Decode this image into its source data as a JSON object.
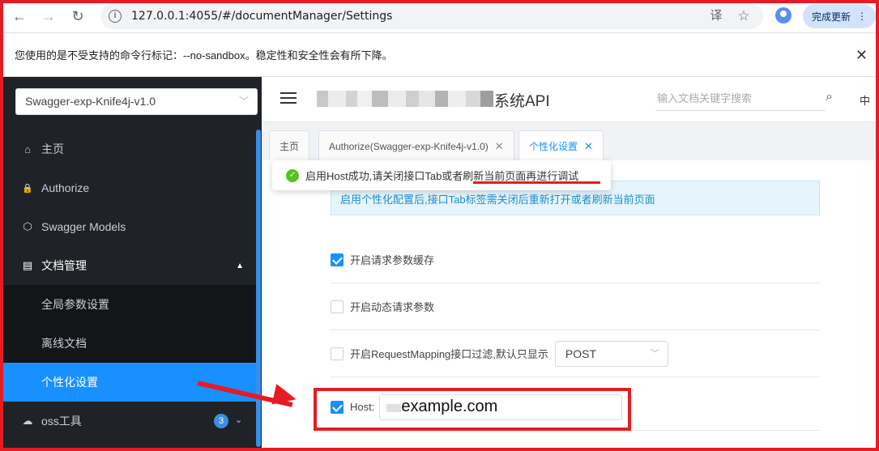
{
  "browser": {
    "back_icon": "←",
    "forward_icon": "→",
    "reload_icon": "↻",
    "url": "127.0.0.1:4055/#/documentManager/Settings",
    "translate_icon": "译",
    "bookmark_icon": "☆",
    "update_label": "完成更新",
    "menu_icon": "⋮"
  },
  "warning": {
    "text": "您使用的是不受支持的命令行标记：--no-sandbox。稳定性和安全性会有所下降。",
    "close_icon": "✕"
  },
  "sidebar": {
    "version_select": "Swagger-exp-Knife4j-v1.0",
    "select_caret": "﹀",
    "items": [
      {
        "label": "主页",
        "icon": "⌂"
      },
      {
        "label": "Authorize",
        "icon": "🔒"
      },
      {
        "label": "Swagger Models",
        "icon": "⬡"
      },
      {
        "label": "文档管理",
        "icon": "▤",
        "expand_icon": "▲"
      }
    ],
    "sub_items": [
      {
        "label": "全局参数设置"
      },
      {
        "label": "离线文档"
      },
      {
        "label": "个性化设置"
      }
    ],
    "oss_item": {
      "label": "oss工具",
      "icon": "☁",
      "badge": "3",
      "caret": "⌄"
    }
  },
  "header": {
    "title": "系统API",
    "search_placeholder": "输入文档关键字搜索",
    "search_icon": "⌕",
    "lang": "中"
  },
  "tabs": [
    {
      "label": "主页",
      "closable": false
    },
    {
      "label": "Authorize(Swagger-exp-Knife4j-v1.0)",
      "closable": true
    },
    {
      "label": "个性化设置",
      "closable": true
    }
  ],
  "tab_close_icon": "✕",
  "toast": {
    "icon": "✓",
    "text": "启用Host成功,请关闭接口Tab或者刷新当前页面再进行调试"
  },
  "alert": {
    "text": "启用个性化配置后,接口Tab标签需关闭后重新打开或者刷新当前页面"
  },
  "options": [
    {
      "label": "开启请求参数缓存",
      "checked": true
    },
    {
      "label": "开启动态请求参数",
      "checked": false
    },
    {
      "label": "开启RequestMapping接口过滤,默认只显示",
      "checked": false,
      "select_value": "POST",
      "select_caret": "﹀"
    },
    {
      "label": "Host:",
      "checked": true,
      "input_value": "example.com"
    }
  ],
  "colors": {
    "accent": "#1890ff",
    "sidebar_bg": "#1f2227",
    "annotation_red": "#e51c23",
    "success": "#52c41a"
  }
}
